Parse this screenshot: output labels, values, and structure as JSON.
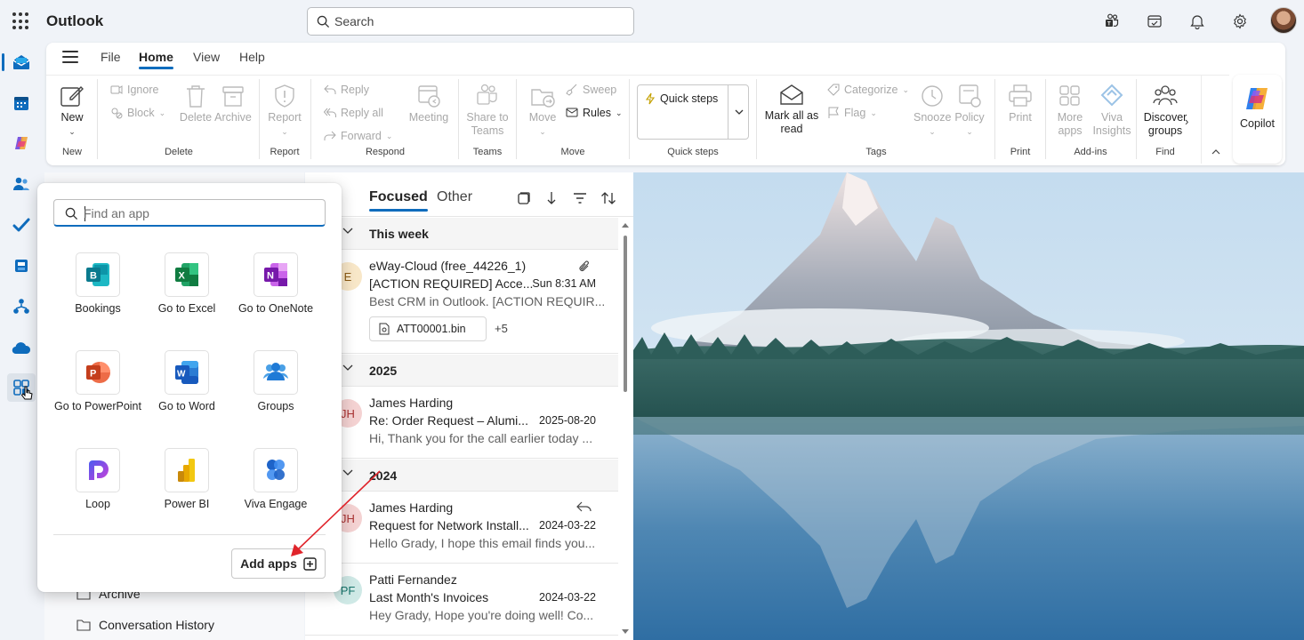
{
  "app": {
    "title": "Outlook"
  },
  "search": {
    "placeholder": "Search"
  },
  "ribbon": {
    "tabs": [
      "File",
      "Home",
      "View",
      "Help"
    ],
    "active_tab": "Home",
    "buttons": {
      "new": "New",
      "ignore": "Ignore",
      "block": "Block",
      "delete": "Delete",
      "archive": "Archive",
      "report": "Report",
      "reply": "Reply",
      "reply_all": "Reply all",
      "forward": "Forward",
      "meeting": "Meeting",
      "share_to_teams": "Share to Teams",
      "move": "Move",
      "sweep": "Sweep",
      "rules": "Rules",
      "quick_steps": "Quick steps",
      "mark_all_read": "Mark all as read",
      "categorize": "Categorize",
      "flag": "Flag",
      "snooze": "Snooze",
      "policy": "Policy",
      "print": "Print",
      "more_apps": "More apps",
      "viva_insights": "Viva Insights",
      "discover_groups": "Discover groups",
      "copilot": "Copilot"
    },
    "groups": [
      "New",
      "Delete",
      "Report",
      "Respond",
      "Teams",
      "Move",
      "Quick steps",
      "Tags",
      "Print",
      "Add-ins",
      "Find"
    ]
  },
  "message_list": {
    "tabs": [
      "Focused",
      "Other"
    ],
    "sections": [
      {
        "title": "This week",
        "messages": [
          {
            "initials": "E",
            "sender": "eWay-Cloud (free_44226_1)",
            "subject": "[ACTION REQUIRED] Acce...",
            "date": "Sun 8:31 AM",
            "preview": "Best CRM in Outlook. [ACTION REQUIR...",
            "attachment": "ATT00001.bin",
            "extra_attachments": "+5"
          }
        ]
      },
      {
        "title": "2025",
        "messages": [
          {
            "initials": "JH",
            "sender": "James Harding",
            "subject": "Re: Order Request – Alumi...",
            "date": "2025-08-20",
            "preview": "Hi, Thank you for the call earlier today ..."
          }
        ]
      },
      {
        "title": "2024",
        "messages": [
          {
            "initials": "JH",
            "sender": "James Harding",
            "subject": "Request for Network Install...",
            "date": "2024-03-22",
            "preview": "Hello Grady, I hope this email finds you..."
          },
          {
            "initials": "PF",
            "sender": "Patti Fernandez",
            "subject": "Last Month's Invoices",
            "date": "2024-03-22",
            "preview": "Hey Grady, Hope you're doing well! Co..."
          }
        ]
      }
    ]
  },
  "folders": [
    "Archive",
    "Conversation History"
  ],
  "app_flyout": {
    "search_placeholder": "Find an app",
    "apps": [
      "Bookings",
      "Go to Excel",
      "Go to OneNote",
      "Go to PowerPoint",
      "Go to Word",
      "Groups",
      "Loop",
      "Power BI",
      "Viva Engage"
    ],
    "add_apps_label": "Add apps"
  },
  "colors": {
    "accent": "#0f6cbd",
    "annotation_arrow": "#e0242b"
  }
}
